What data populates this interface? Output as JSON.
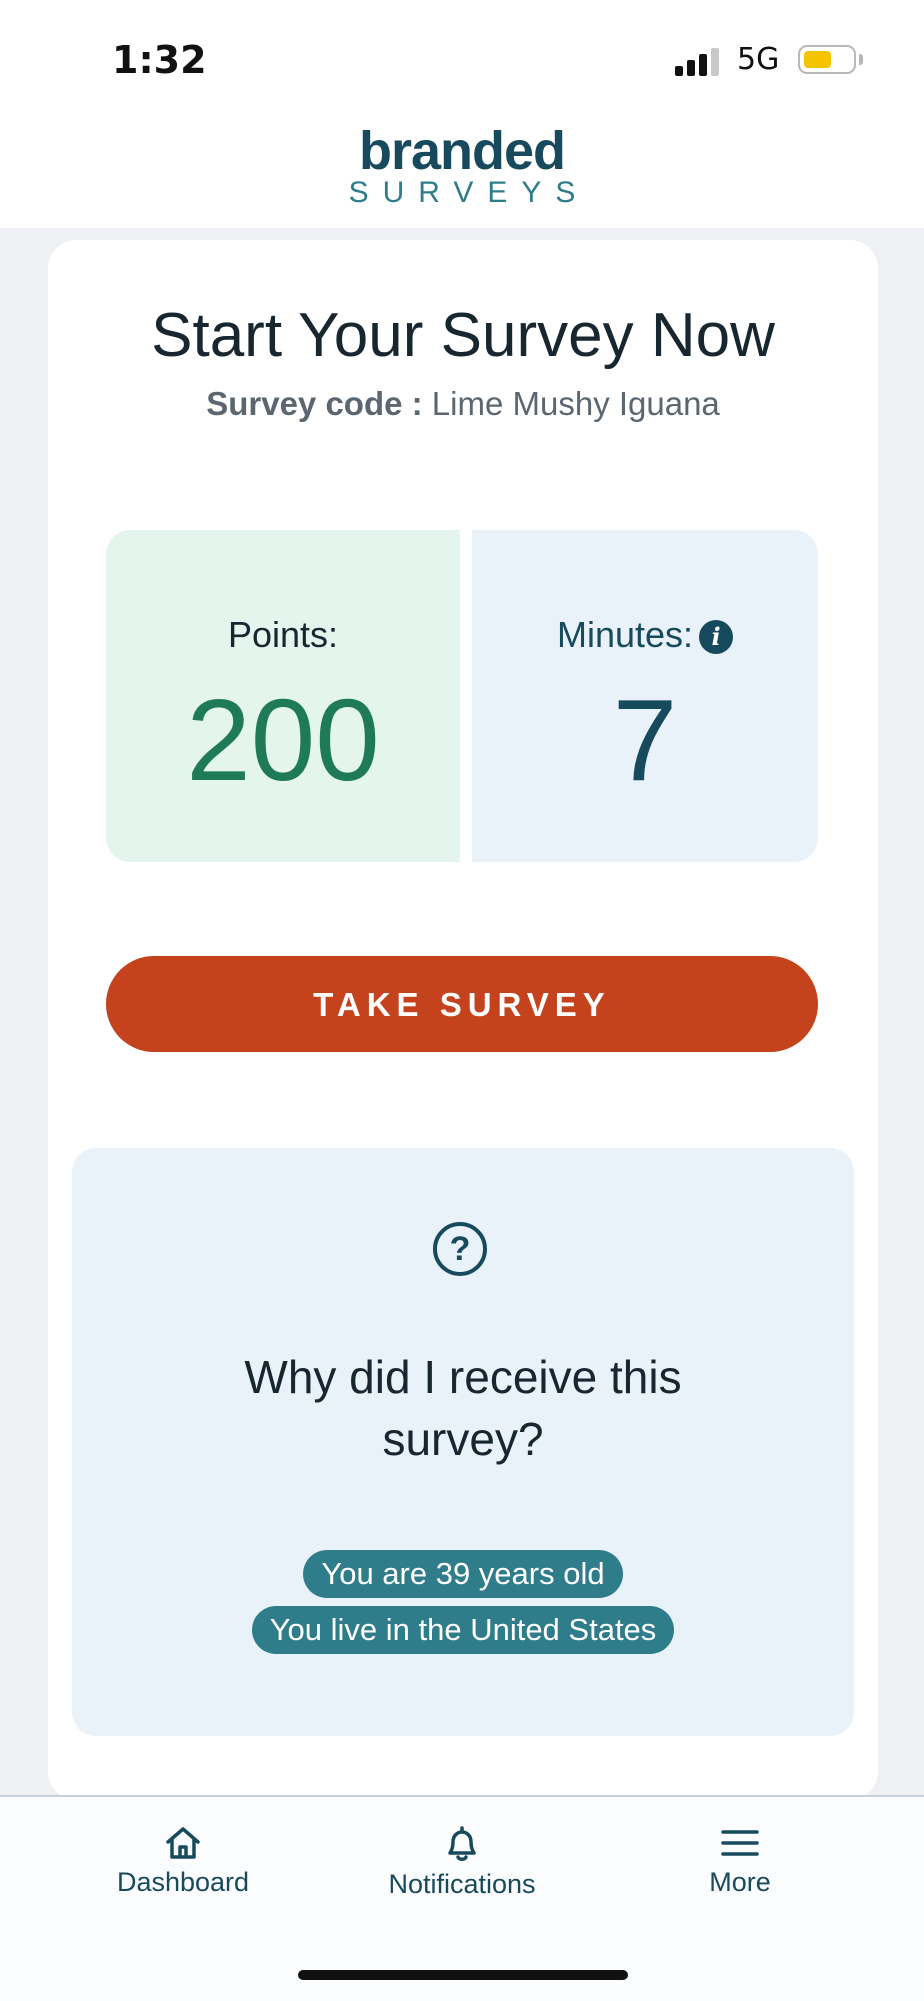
{
  "status_bar": {
    "time": "1:32",
    "network": "5G"
  },
  "header": {
    "logo_top": "branded",
    "logo_bottom": "SURVEYS"
  },
  "survey": {
    "title": "Start Your Survey Now",
    "code_label": "Survey code :",
    "code_value": "Lime Mushy Iguana",
    "points_label": "Points:",
    "points_value": "200",
    "minutes_label": "Minutes:",
    "minutes_value": "7",
    "take_button": "TAKE SURVEY"
  },
  "why": {
    "title": "Why did I receive this survey?",
    "reasons": [
      "You are 39 years old",
      "You live in the United States"
    ]
  },
  "tab_bar": {
    "items": [
      {
        "label": "Dashboard",
        "icon": "home-icon"
      },
      {
        "label": "Notifications",
        "icon": "bell-icon"
      },
      {
        "label": "More",
        "icon": "menu-icon"
      }
    ]
  },
  "colors": {
    "brand": "#174a5c",
    "accent": "#c4431c",
    "points_green": "#1e7a58",
    "chip_teal": "#2f7d8a"
  }
}
